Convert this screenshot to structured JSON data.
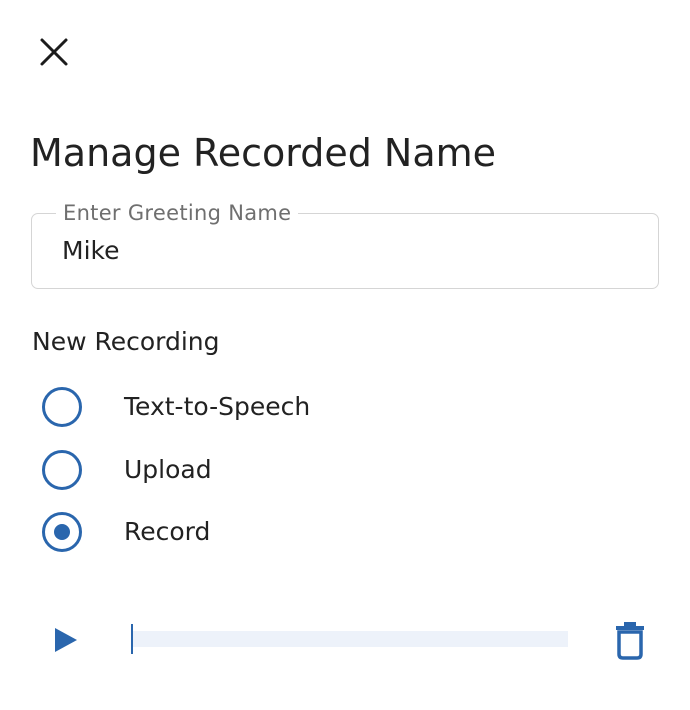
{
  "dialog": {
    "close_icon": "close-icon",
    "title": "Manage Recorded Name"
  },
  "greeting_field": {
    "label": "Enter Greeting Name",
    "value": "Mike"
  },
  "new_recording": {
    "heading": "New Recording",
    "options": [
      {
        "label": "Text-to-Speech",
        "selected": false
      },
      {
        "label": "Upload",
        "selected": false
      },
      {
        "label": "Record",
        "selected": true
      }
    ]
  },
  "player": {
    "play_icon": "play-icon",
    "progress_fraction": 0,
    "delete_icon": "trash-icon"
  },
  "colors": {
    "accent": "#2a66ad",
    "track": "#edf2fa",
    "border": "#d5d5d5",
    "label_gray": "#6f6f6f",
    "text": "#222222"
  }
}
